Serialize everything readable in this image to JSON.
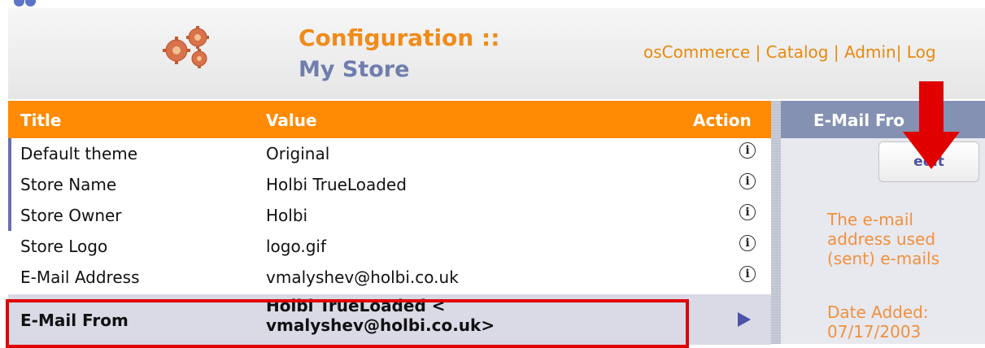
{
  "header": {
    "title_line1": "Configuration ::",
    "title_line2": "My Store",
    "nav": [
      {
        "label": "osCommerce"
      },
      {
        "label": "Catalog"
      },
      {
        "label": "Admin"
      },
      {
        "label": "Log"
      }
    ]
  },
  "table": {
    "columns": {
      "title": "Title",
      "value": "Value",
      "action": "Action"
    },
    "rows": [
      {
        "title": "Default theme",
        "value": "Original"
      },
      {
        "title": "Store Name",
        "value": "Holbi TrueLoaded"
      },
      {
        "title": "Store Owner",
        "value": "Holbi"
      },
      {
        "title": "Store Logo",
        "value": "logo.gif"
      },
      {
        "title": "E-Mail Address",
        "value": "vmalyshev@holbi.co.uk"
      },
      {
        "title": "E-Mail From",
        "value": "Holbi TrueLoaded < vmalyshev@holbi.co.uk>"
      }
    ]
  },
  "side_panel": {
    "heading": "E-Mail Fro",
    "edit_label": "edit",
    "description": "The e-mail address used (sent) e-mails",
    "date_added": "Date Added: 07/17/2003"
  },
  "colors": {
    "accent_orange": "#ff8a04",
    "side_header": "#8491b3",
    "annotation_red": "#e00000"
  },
  "icons": [
    "gears-icon",
    "info-icon",
    "play-arrow-icon",
    "annotation-arrow-icon"
  ]
}
